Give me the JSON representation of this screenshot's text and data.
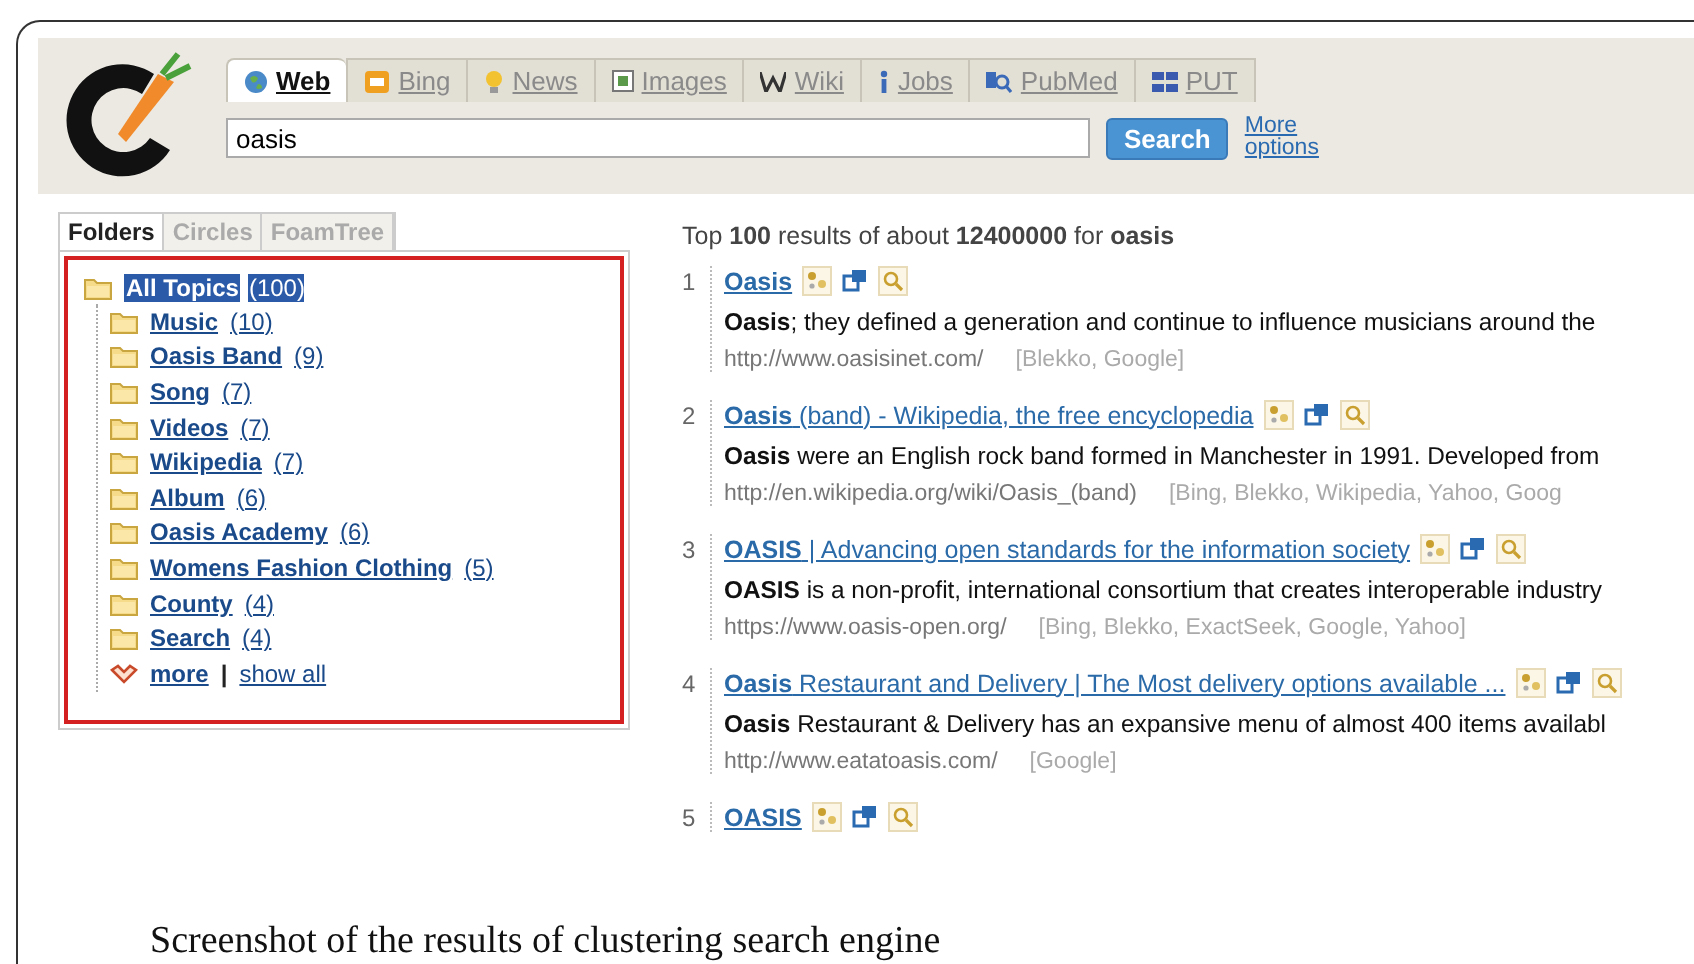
{
  "tabs": [
    {
      "label": "Web",
      "selected": true
    },
    {
      "label": "Bing",
      "selected": false
    },
    {
      "label": "News",
      "selected": false
    },
    {
      "label": "Images",
      "selected": false
    },
    {
      "label": "Wiki",
      "selected": false
    },
    {
      "label": "Jobs",
      "selected": false
    },
    {
      "label": "PubMed",
      "selected": false
    },
    {
      "label": "PUT",
      "selected": false
    }
  ],
  "search": {
    "value": "oasis",
    "button": "Search",
    "more_options": "More options"
  },
  "view_tabs": [
    {
      "label": "Folders",
      "selected": true
    },
    {
      "label": "Circles",
      "selected": false
    },
    {
      "label": "FoamTree",
      "selected": false
    }
  ],
  "tree": {
    "label": "All Topics",
    "count": "(100)",
    "selected": true,
    "children": [
      {
        "label": "Music",
        "count": "(10)",
        "selected": false
      },
      {
        "label": "Oasis Band",
        "count": "(9)",
        "selected": false
      },
      {
        "label": "Song",
        "count": "(7)",
        "selected": false
      },
      {
        "label": "Videos",
        "count": "(7)",
        "selected": false
      },
      {
        "label": "Wikipedia",
        "count": "(7)",
        "selected": false
      },
      {
        "label": "Album",
        "count": "(6)",
        "selected": false
      },
      {
        "label": "Oasis Academy",
        "count": "(6)",
        "selected": false
      },
      {
        "label": "Womens Fashion Clothing",
        "count": "(5)",
        "selected": false
      },
      {
        "label": "County",
        "count": "(4)",
        "selected": false
      },
      {
        "label": "Search",
        "count": "(4)",
        "selected": false
      }
    ],
    "more": "more",
    "separator": "|",
    "show_all": "show all"
  },
  "summary": "Top **100** results of about **12400000** for **oasis**",
  "results": [
    {
      "number": "1",
      "title": "**Oasis**",
      "snippet": "**Oasis**; they defined a generation and continue to influence musicians around the",
      "url": "http://www.oasisinet.com/",
      "sources": "[Blekko, Google]"
    },
    {
      "number": "2",
      "title": "**Oasis** (band) - Wikipedia, the free encyclopedia",
      "snippet": "**Oasis** were an English rock band formed in Manchester in 1991. Developed from",
      "url": "http://en.wikipedia.org/wiki/Oasis_(band)",
      "sources": "[Bing, Blekko, Wikipedia, Yahoo, Goog"
    },
    {
      "number": "3",
      "title": "**OASIS** | Advancing open standards for the information society",
      "snippet": "**OASIS** is a non-profit, international consortium that creates interoperable industry",
      "url": "https://www.oasis-open.org/",
      "sources": "[Bing, Blekko, ExactSeek, Google, Yahoo]"
    },
    {
      "number": "4",
      "title": "**Oasis** Restaurant and Delivery | The Most delivery options available ...",
      "snippet": "**Oasis** Restaurant & Delivery has an expansive menu of almost 400 items availabl",
      "url": "http://www.eatatoasis.com/",
      "sources": "[Google]"
    },
    {
      "number": "5",
      "title": "**OASIS**"
    }
  ],
  "caption": "Screenshot of the results of clustering search engine"
}
